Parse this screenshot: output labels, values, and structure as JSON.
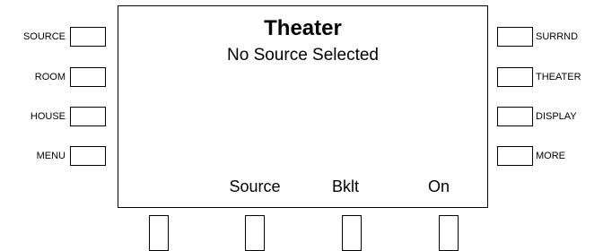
{
  "left_keys": [
    "SOURCE",
    "ROOM",
    "HOUSE",
    "MENU"
  ],
  "right_keys": [
    "SURRND",
    "THEATER",
    "DISPLAY",
    "MORE"
  ],
  "screen": {
    "title": "Theater",
    "status": "No Source Selected",
    "soft_labels": [
      "Source",
      "Bklt",
      "On"
    ]
  }
}
